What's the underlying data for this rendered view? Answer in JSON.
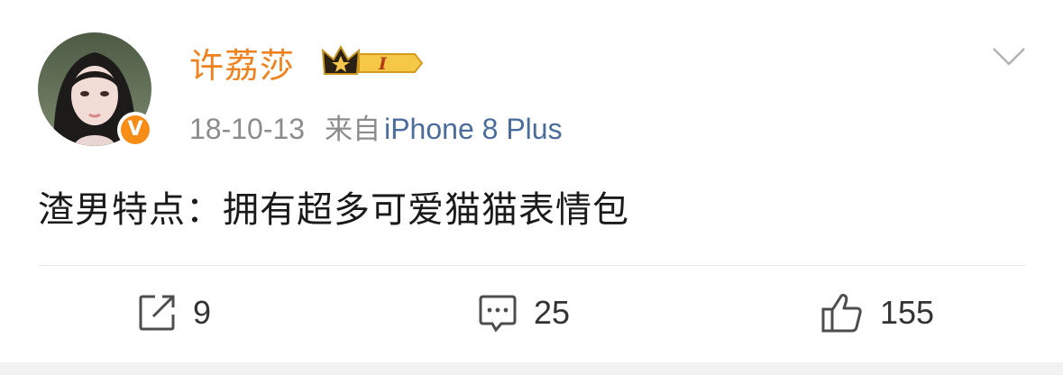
{
  "user": {
    "name": "许荔莎",
    "level_badge": "I",
    "verified_mark": "V"
  },
  "meta": {
    "date": "18-10-13",
    "from_label": "来自",
    "device": "iPhone 8 Plus"
  },
  "post": {
    "text": "渣男特点：拥有超多可爱猫猫表情包"
  },
  "actions": {
    "repost_count": "9",
    "comment_count": "25",
    "like_count": "155"
  },
  "icons": {
    "repost": "share-out-icon",
    "comment": "comment-bubble-icon",
    "like": "thumbs-up-icon",
    "menu": "chevron-down-icon",
    "badge": "crown-badge-icon"
  },
  "colors": {
    "username": "#f0821e",
    "device_link": "#4a6d9c",
    "verified": "#f78d17"
  }
}
